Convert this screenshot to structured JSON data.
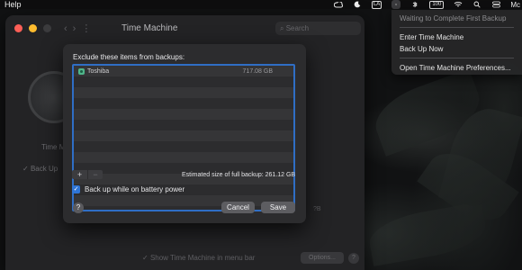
{
  "menubar": {
    "app_menu": "Help",
    "status_right_label": "Mc",
    "battery_label": "100",
    "input_source": "LA"
  },
  "tm_menu": {
    "items": [
      {
        "label": "Waiting to Complete First Backup",
        "enabled": false
      },
      {
        "label": "Enter Time Machine",
        "enabled": true
      },
      {
        "label": "Back Up Now",
        "enabled": true
      },
      {
        "label": "Open Time Machine Preferences...",
        "enabled": true
      }
    ]
  },
  "pref_window": {
    "title": "Time Machine",
    "search_placeholder": "Search",
    "tm_label": "Time M",
    "backup_check_label": "Back Up",
    "side_text": "?B",
    "bottom_check_label": "Show Time Machine in menu bar",
    "options_label": "Options...",
    "help_label": "?"
  },
  "sheet": {
    "heading": "Exclude these items from backups:",
    "items": [
      {
        "name": "Toshiba",
        "size": "717.08 GB",
        "icon": "external-disk-icon"
      }
    ],
    "add_label": "+",
    "remove_label": "−",
    "estimate": "Estimated size of full backup: 261.12 GB",
    "battery_checkbox_label": "Back up while on battery power",
    "battery_checkbox_checked": true,
    "help_label": "?",
    "cancel_label": "Cancel",
    "save_label": "Save"
  },
  "colors": {
    "accent": "#2f75d6",
    "list_border": "#2f6ec5",
    "close": "#fe5f57",
    "minimize": "#febc2e"
  }
}
